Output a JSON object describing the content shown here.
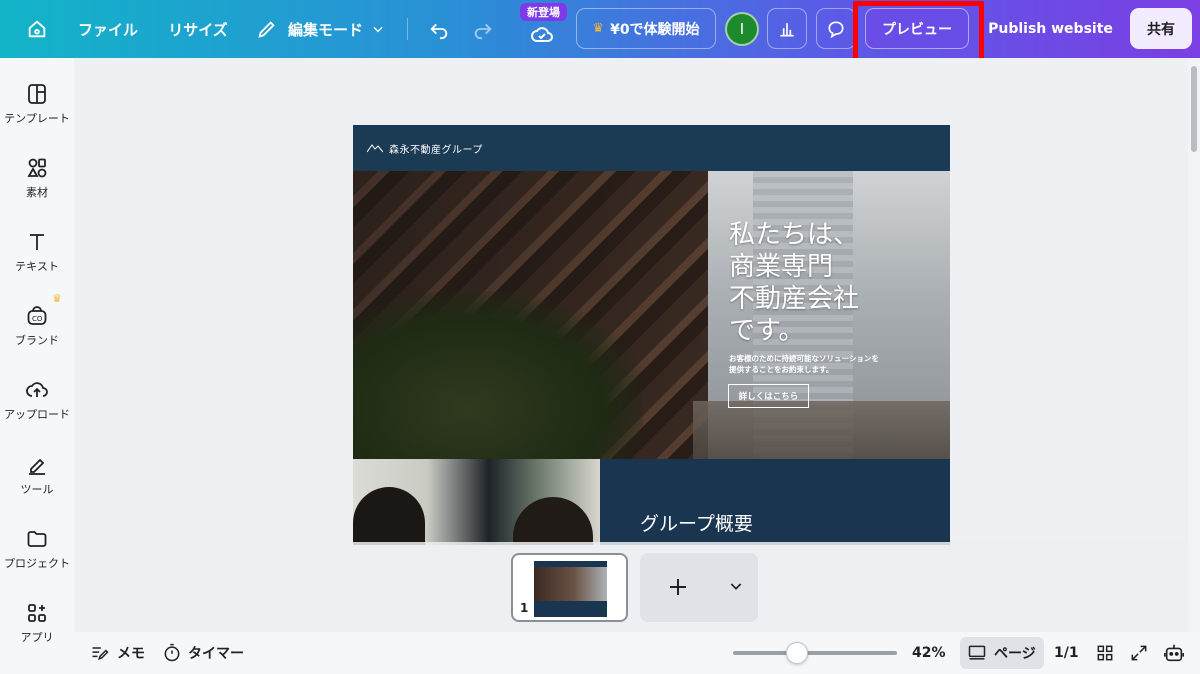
{
  "topbar": {
    "file": "ファイル",
    "resize": "リサイズ",
    "edit_mode": "編集モード",
    "new_badge": "新登場",
    "trial": "¥0で体験開始",
    "avatar_initial": "I",
    "preview": "プレビュー",
    "publish": "Publish website",
    "share": "共有"
  },
  "sidebar": {
    "items": [
      {
        "label": "テンプレート",
        "icon": "template-icon"
      },
      {
        "label": "素材",
        "icon": "elements-icon"
      },
      {
        "label": "テキスト",
        "icon": "text-icon"
      },
      {
        "label": "ブランド",
        "icon": "brand-icon"
      },
      {
        "label": "アップロード",
        "icon": "upload-icon"
      },
      {
        "label": "ツール",
        "icon": "tools-icon"
      },
      {
        "label": "プロジェクト",
        "icon": "folder-icon"
      },
      {
        "label": "アプリ",
        "icon": "apps-icon"
      }
    ]
  },
  "design": {
    "logo_text": "森永不動産グループ",
    "hero_title": "私たちは、\n商業専門\n不動産会社\nです。",
    "hero_sub": "お客様のために持続可能なソリューションを\n提供することをお約束します。",
    "hero_cta": "詳しくはこちら",
    "section2_title": "グループ概要"
  },
  "pages": {
    "current_number": "1"
  },
  "bottombar": {
    "notes": "メモ",
    "timer": "タイマー",
    "zoom": "42%",
    "zoom_fraction": 0.42,
    "page_view": "ページ",
    "page_count": "1/1"
  },
  "colors": {
    "accent_highlight": "#ff0000",
    "design_navy": "#1b3a54"
  }
}
